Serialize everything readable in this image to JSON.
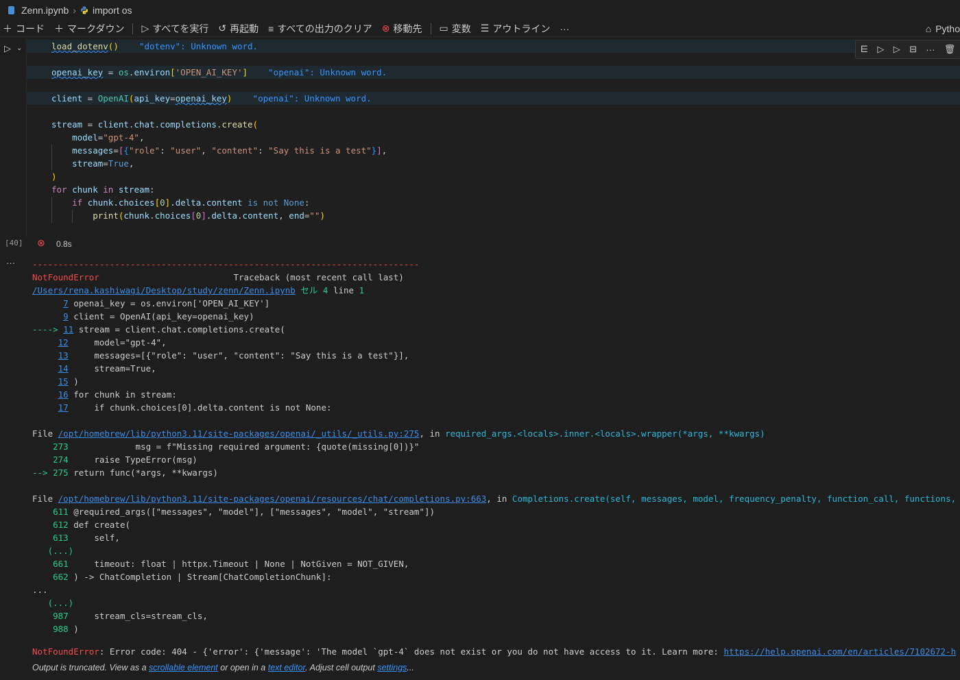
{
  "breadcrumb": {
    "file": "Zenn.ipynb",
    "cell": "import os"
  },
  "toolbar": {
    "code": "コード",
    "markdown": "マークダウン",
    "run_all": "すべてを実行",
    "restart": "再起動",
    "clear_outputs": "すべての出力のクリア",
    "goto": "移動先",
    "variables": "変数",
    "outline": "アウトライン",
    "more": "···",
    "kernel": "Pytho"
  },
  "cell": {
    "exec_count": "[40]",
    "duration": "0.8s",
    "diag_dotenv": "\"dotenv\": Unknown word.",
    "diag_openai_1": "\"openai\": Unknown word.",
    "diag_openai_2": "\"openai\": Unknown word."
  },
  "output": {
    "dashes": "---------------------------------------------------------------------------",
    "error_name": "NotFoundError",
    "traceback_header": "                          Traceback (most recent call last)",
    "cell_path": "/Users/rena.kashiwagi/Desktop/study/zenn/Zenn.ipynb",
    "cell_label": "セル 4",
    "line_label": "line",
    "line_num": "1",
    "file1_path": "/opt/homebrew/lib/python3.11/site-packages/openai/_utils/_utils.py:275",
    "file1_func": "required_args.<locals>.inner.<locals>.wrapper(*args, **kwargs)",
    "file2_path": "/opt/homebrew/lib/python3.11/site-packages/openai/resources/chat/completions.py:663",
    "file2_func": "Completions.create(self, messages, model, frequency_penalty, function_call, functions,",
    "final_error": "Error code: 404 - {'error': {'message': 'The model `gpt-4` does not exist or you do not have access to it. Learn more: ",
    "final_link": "https://help.openai.com/en/articles/7102672-h",
    "trunc_prefix": "Output is truncated. View as a ",
    "trunc_link1": "scrollable element",
    "trunc_mid": " or open in a ",
    "trunc_link2": "text editor",
    "trunc_mid2": ". Adjust cell output ",
    "trunc_link3": "settings",
    "trunc_end": "..."
  }
}
